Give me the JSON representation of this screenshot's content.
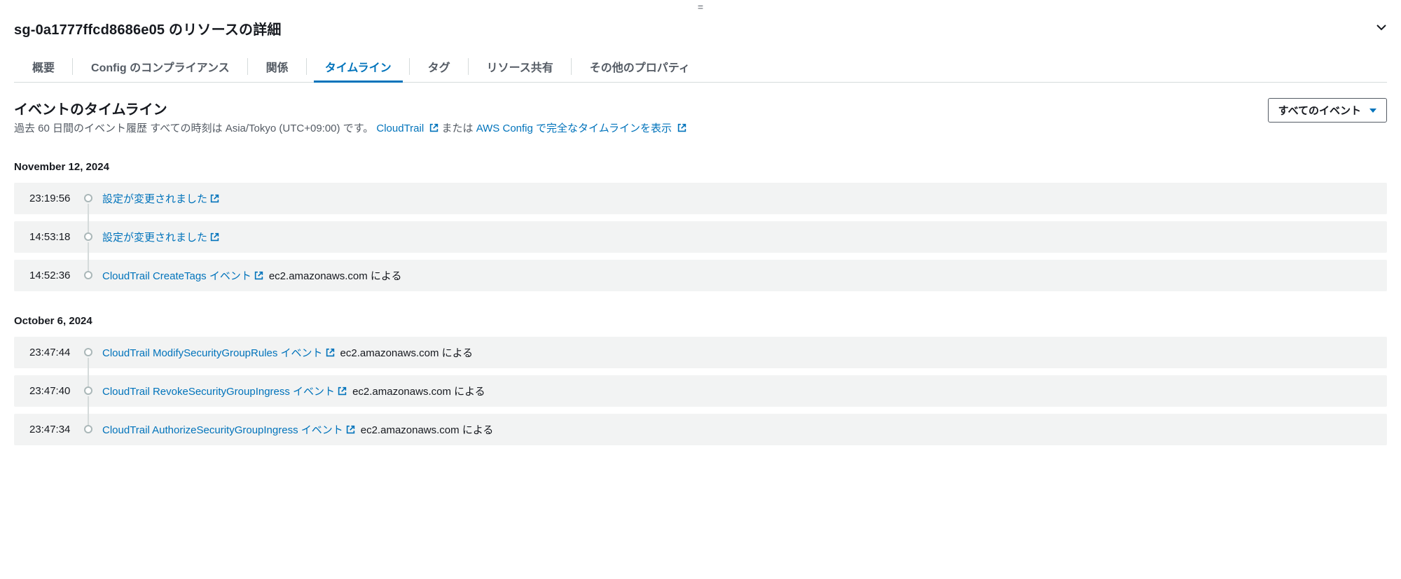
{
  "page": {
    "title": "sg-0a1777ffcd8686e05 のリソースの詳細"
  },
  "tabs": [
    {
      "label": "概要",
      "active": false
    },
    {
      "label": "Config のコンプライアンス",
      "active": false
    },
    {
      "label": "関係",
      "active": false
    },
    {
      "label": "タイムライン",
      "active": true
    },
    {
      "label": "タグ",
      "active": false
    },
    {
      "label": "リソース共有",
      "active": false
    },
    {
      "label": "その他のプロパティ",
      "active": false
    }
  ],
  "timeline": {
    "heading": "イベントのタイムライン",
    "subtitle_prefix": "過去 60 日間のイベント履歴  すべての時刻は Asia/Tokyo (UTC+09:00) です。",
    "link_cloudtrail": "CloudTrail",
    "subtitle_mid": " または ",
    "link_awsconfig": "AWS Config で完全なタイムラインを表示",
    "filter_label": "すべてのイベント",
    "groups": [
      {
        "date": "November 12, 2024",
        "events": [
          {
            "time": "23:19:56",
            "link": "設定が変更されました",
            "extra": ""
          },
          {
            "time": "14:53:18",
            "link": "設定が変更されました",
            "extra": ""
          },
          {
            "time": "14:52:36",
            "link": "CloudTrail CreateTags イベント",
            "extra": "ec2.amazonaws.com による"
          }
        ]
      },
      {
        "date": "October 6, 2024",
        "events": [
          {
            "time": "23:47:44",
            "link": "CloudTrail ModifySecurityGroupRules イベント",
            "extra": "ec2.amazonaws.com による"
          },
          {
            "time": "23:47:40",
            "link": "CloudTrail RevokeSecurityGroupIngress イベント",
            "extra": "ec2.amazonaws.com による"
          },
          {
            "time": "23:47:34",
            "link": "CloudTrail AuthorizeSecurityGroupIngress イベント",
            "extra": "ec2.amazonaws.com による"
          }
        ]
      }
    ]
  }
}
